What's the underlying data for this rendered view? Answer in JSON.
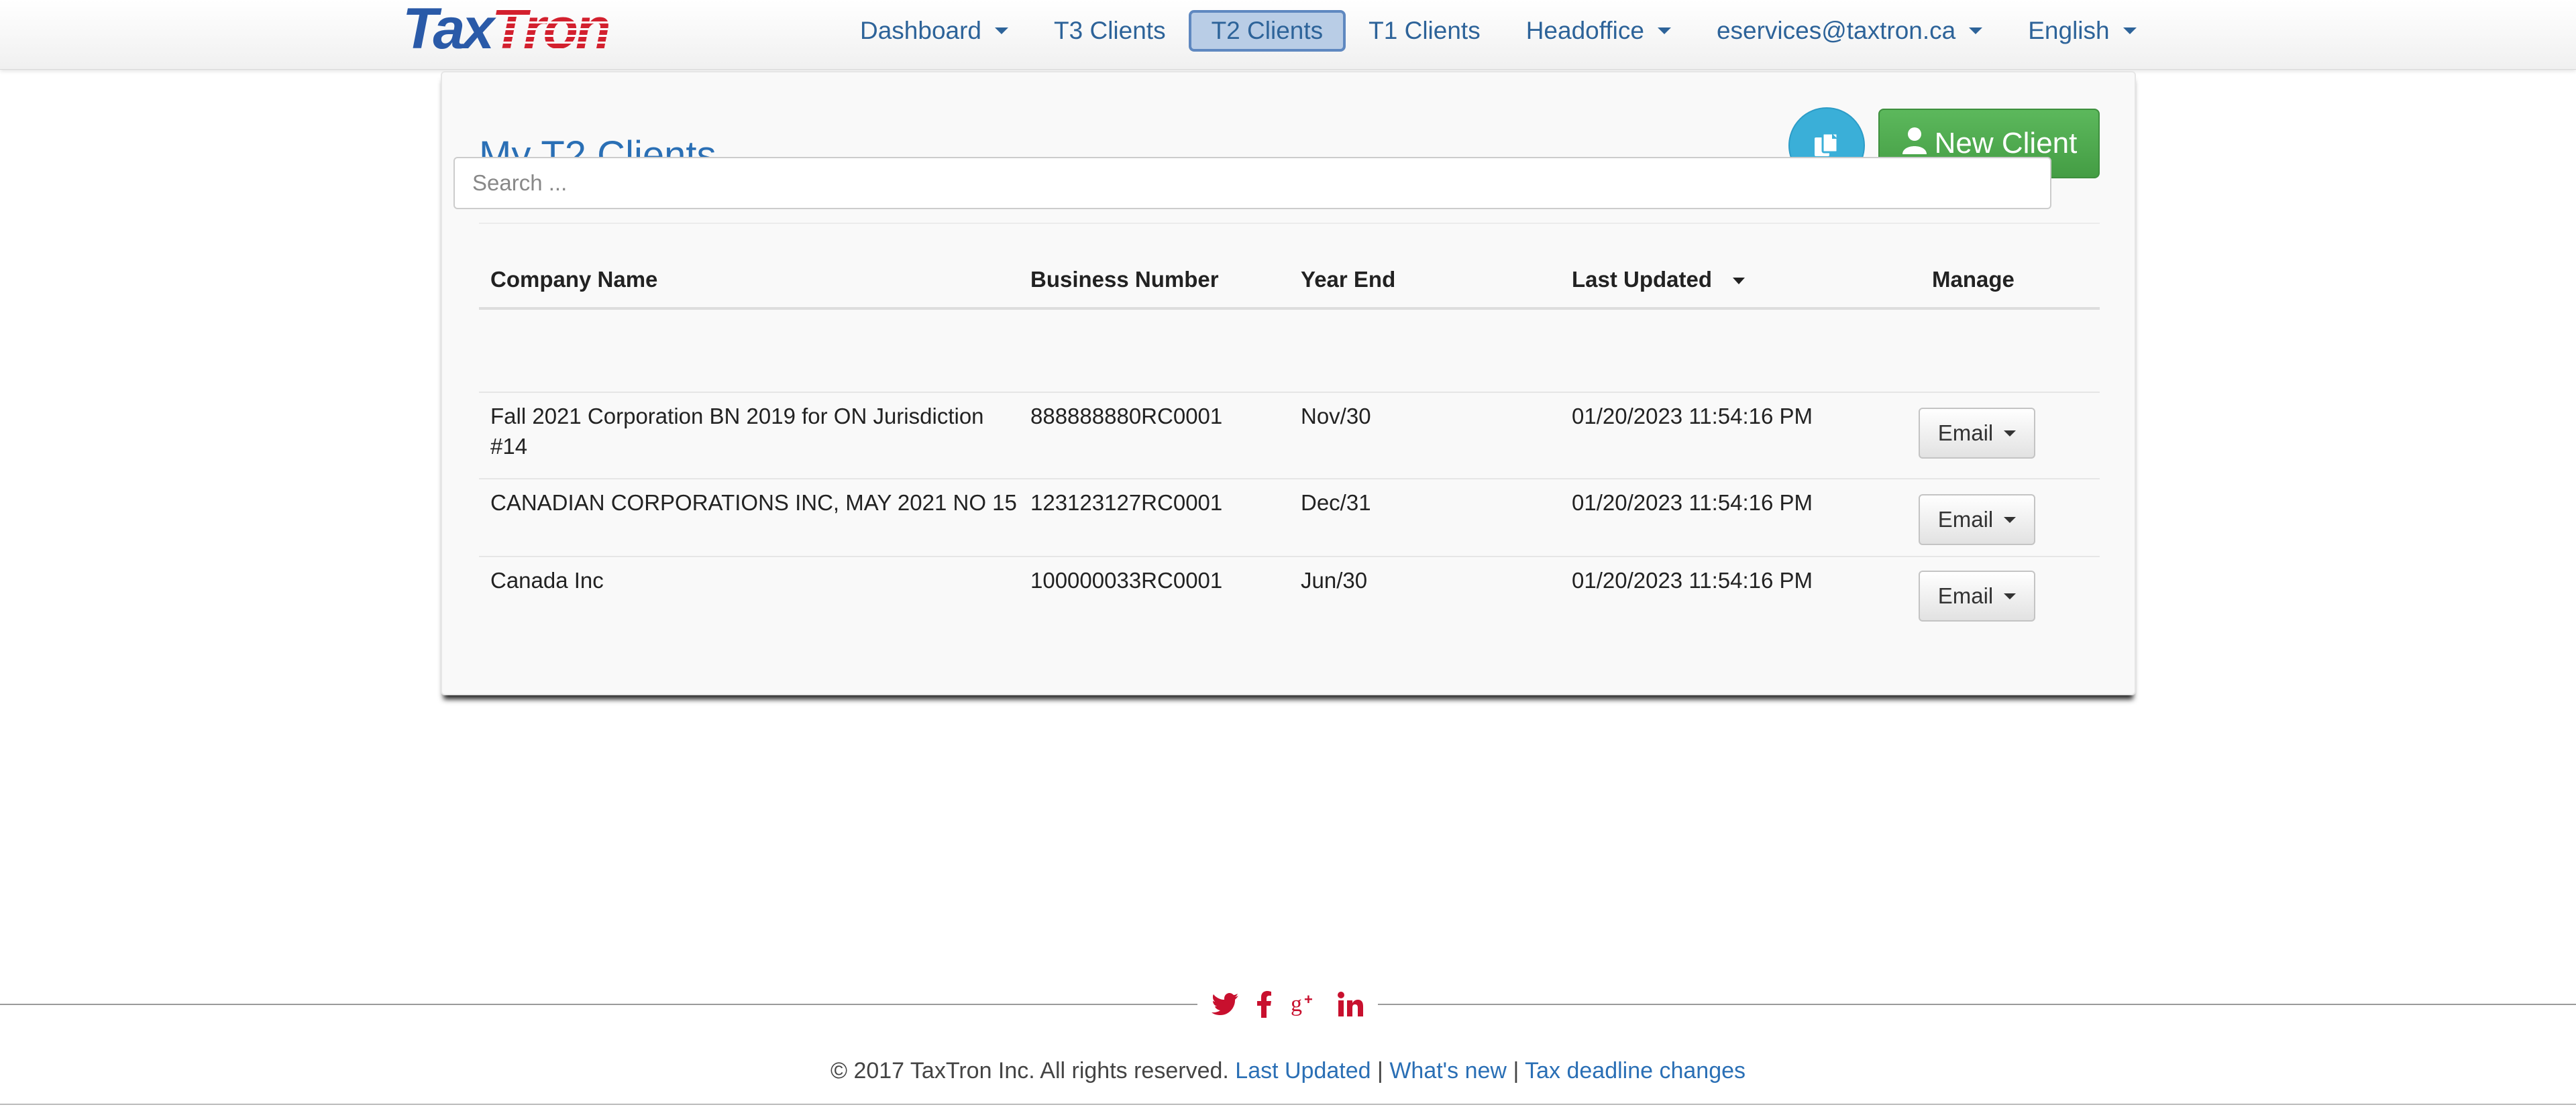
{
  "brand": {
    "logo_part1": "Tax",
    "logo_part2": "Tron"
  },
  "nav": {
    "items": [
      {
        "label": "Dashboard",
        "dropdown": true
      },
      {
        "label": "T3 Clients",
        "dropdown": false
      },
      {
        "label": "T2 Clients",
        "dropdown": false,
        "active": true
      },
      {
        "label": "T1 Clients",
        "dropdown": false
      },
      {
        "label": "Headoffice",
        "dropdown": true
      },
      {
        "label": "eservices@taxtron.ca",
        "dropdown": true
      },
      {
        "label": "English",
        "dropdown": true
      }
    ]
  },
  "page": {
    "title": "My T2 Clients",
    "copy_button_icon": "copy-icon",
    "new_client_label": "New Client",
    "new_client_icon": "user-icon"
  },
  "table": {
    "headers": {
      "company": "Company Name",
      "business_number": "Business Number",
      "year_end": "Year End",
      "last_updated": "Last Updated",
      "manage": "Manage"
    },
    "search_placeholder": "Search ...",
    "rows": [
      {
        "company_line1": "Fall 2021 Corporation BN 2019 for ON Jurisdiction",
        "company_line2": "#14",
        "business_number": "888888880RC0001",
        "year_end": "Nov/30",
        "last_updated": "01/20/2023 11:54:16 PM",
        "action": "Email"
      },
      {
        "company_line1": "CANADIAN CORPORATIONS INC, MAY 2021 NO 15",
        "company_line2": "",
        "business_number": "123123127RC0001",
        "year_end": "Dec/31",
        "last_updated": "01/20/2023 11:54:16 PM",
        "action": "Email"
      },
      {
        "company_line1": "Canada Inc",
        "company_line2": "",
        "business_number": "100000033RC0001",
        "year_end": "Jun/30",
        "last_updated": "01/20/2023 11:54:16 PM",
        "action": "Email"
      }
    ]
  },
  "footer": {
    "copyright": "© 2017 TaxTron Inc. All rights reserved.",
    "links": [
      "Last Updated",
      "What's new",
      "Tax deadline changes"
    ],
    "separator": "|",
    "social_icons": [
      "twitter-icon",
      "facebook-icon",
      "google-plus-icon",
      "linkedin-icon"
    ]
  },
  "colors": {
    "link": "#2a6fb5",
    "nav_text": "#2d6399",
    "primary_green": "#5cb85c",
    "info_blue": "#3aafd8",
    "social_red": "#c8102e",
    "logo_blue": "#2a5aa8",
    "logo_red": "#d3202e"
  }
}
